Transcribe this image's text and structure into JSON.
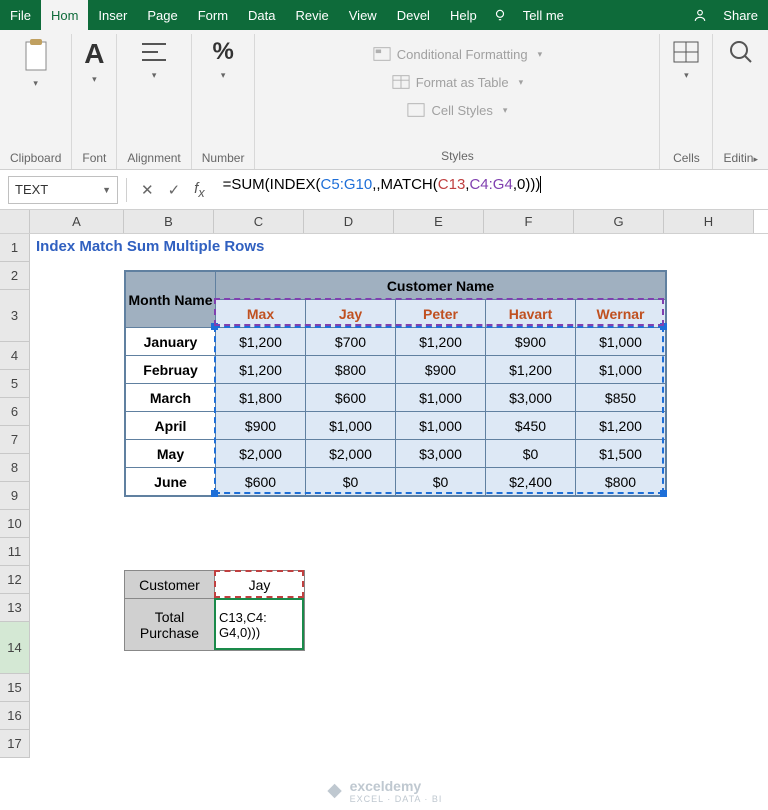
{
  "menu": {
    "items": [
      "File",
      "Hom",
      "Inser",
      "Page",
      "Form",
      "Data",
      "Revie",
      "View",
      "Devel",
      "Help"
    ],
    "active_index": 1,
    "tellme": "Tell me",
    "share": "Share"
  },
  "ribbon": {
    "clipboard": "Clipboard",
    "font": "Font",
    "alignment": "Alignment",
    "number": "Number",
    "cells": "Cells",
    "editing": "Editin",
    "styles_label": "Styles",
    "cond_fmt": "Conditional Formatting",
    "fmt_table": "Format as Table",
    "cell_styles": "Cell Styles"
  },
  "formula_bar": {
    "name_box": "TEXT",
    "formula_parts": {
      "prefix": "=SUM(INDEX(",
      "ref1": "C5:G10",
      "mid1": ",,MATCH(",
      "ref2": "C13",
      "mid2": ",",
      "ref3": "C4:G4",
      "suffix": ",0)))"
    }
  },
  "grid": {
    "columns": [
      "A",
      "B",
      "C",
      "D",
      "E",
      "F",
      "G",
      "H"
    ],
    "row_count": 17,
    "title": "Index Match Sum Multiple Rows"
  },
  "data_table": {
    "month_header": "Month Name",
    "customer_header": "Customer Name",
    "customers": [
      "Max",
      "Jay",
      "Peter",
      "Havart",
      "Wernar"
    ],
    "months": [
      "January",
      "Februay",
      "March",
      "April",
      "May",
      "June"
    ],
    "values": [
      [
        "$1,200",
        "$700",
        "$1,200",
        "$900",
        "$1,000"
      ],
      [
        "$1,200",
        "$800",
        "$900",
        "$1,200",
        "$1,000"
      ],
      [
        "$1,800",
        "$600",
        "$1,000",
        "$3,000",
        "$850"
      ],
      [
        "$900",
        "$1,000",
        "$1,000",
        "$450",
        "$1,200"
      ],
      [
        "$2,000",
        "$2,000",
        "$3,000",
        "$0",
        "$1,500"
      ],
      [
        "$600",
        "$0",
        "$0",
        "$2,400",
        "$800"
      ]
    ]
  },
  "lookup": {
    "customer_label": "Customer",
    "customer_value": "Jay",
    "total_label_1": "Total",
    "total_label_2": "Purchase",
    "editing_display_1": "C13,C4:",
    "editing_display_2": "G4,0)))"
  },
  "watermark": {
    "brand": "exceldemy",
    "sub": "EXCEL · DATA · BI"
  }
}
